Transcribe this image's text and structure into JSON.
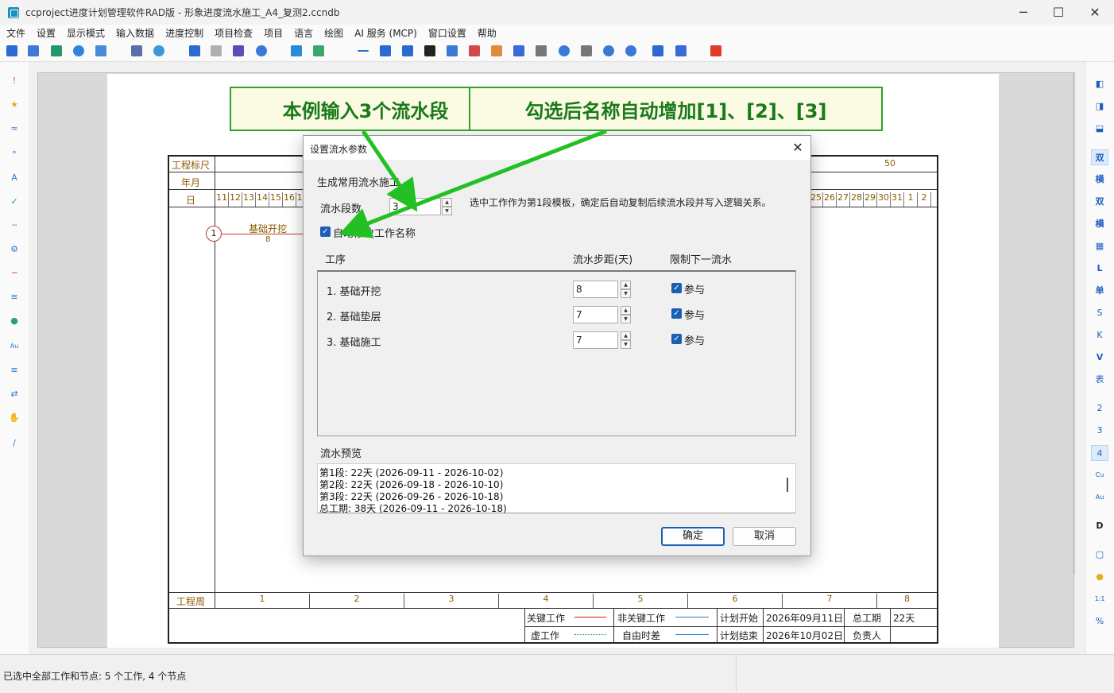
{
  "window": {
    "title": "ccproject进度计划管理软件RAD版 - 形象进度流水施工_A4_复测2.ccndb",
    "min_icon": "─",
    "max_icon": "☐",
    "close_icon": "✕"
  },
  "menu": [
    "文件",
    "设置",
    "显示模式",
    "输入数据",
    "进度控制",
    "项目检查",
    "项目",
    "语言",
    "绘图",
    "AI 服务 (MCP)",
    "窗口设置",
    "帮助"
  ],
  "right_sidebar": [
    "双",
    "横",
    "双",
    "横",
    "L",
    "单",
    "S",
    "K",
    "V",
    "表",
    "2",
    "3",
    "4",
    "Cu",
    "Au",
    "D",
    "1:1",
    "%"
  ],
  "chart": {
    "ruler_label": "工程标尺",
    "ruler_mark": "50",
    "yearmonth_label": "年月",
    "day_label": "日",
    "days_left": [
      "11",
      "12",
      "13",
      "14",
      "15",
      "16",
      "1"
    ],
    "days_right": [
      "25",
      "26",
      "27",
      "28",
      "29",
      "30",
      "31",
      "1",
      "2"
    ],
    "task_node": "1",
    "task_name": "基础开挖",
    "task_duration": "8",
    "week_label": "工程周",
    "weeks": [
      "1",
      "2",
      "3",
      "4",
      "5",
      "6",
      "7",
      "8"
    ],
    "legend": {
      "critical": "关键工作",
      "noncritical": "非关键工作",
      "plan_start_label": "计划开始",
      "plan_start": "2026年09月11日",
      "total_period_label": "总工期",
      "total_period": "22天",
      "virtual": "虚工作",
      "free_float": "自由时差",
      "plan_end_label": "计划结束",
      "plan_end": "2026年10月02日",
      "owner_label": "负责人",
      "owner": ""
    }
  },
  "callouts": {
    "left": "本例输入3个流水段",
    "right": "勾选后名称自动增加[1]、[2]、[3]"
  },
  "dialog": {
    "title": "设置流水参数",
    "close_icon": "✕",
    "section_title": "生成常用流水施工",
    "count_label": "流水段数",
    "count_value": "3",
    "hint": "选中工作作为第1段模板，确定后自动复制后续流水段并写入逻辑关系。",
    "auto_rename_label": "自动修改工作名称",
    "auto_rename_checked": true,
    "col_process": "工序",
    "col_step": "流水步距(天)",
    "col_limit": "限制下一流水",
    "rows": [
      {
        "name": "1. 基础开挖",
        "step": "8",
        "participate": "参与",
        "checked": true
      },
      {
        "name": "2. 基础垫层",
        "step": "7",
        "participate": "参与",
        "checked": true
      },
      {
        "name": "3. 基础施工",
        "step": "7",
        "participate": "参与",
        "checked": true
      }
    ],
    "preview_title": "流水预览",
    "preview_lines": [
      "第1段: 22天 (2026-09-11 - 2026-10-02)",
      "第2段: 22天 (2026-09-18 - 2026-10-10)",
      "第3段: 22天 (2026-09-26 - 2026-10-18)",
      "总工期: 38天 (2026-09-11 - 2026-10-18)"
    ],
    "ok": "确定",
    "cancel": "取消"
  },
  "status": "已选中全部工作和节点: 5 个工作, 4 个节点",
  "colors": {
    "accent_green": "#2ea02e",
    "callout_bg": "#fbfbe4",
    "checkbox_blue": "#1a5fb4",
    "chart_brown": "#8b5a00",
    "critical_red": "#e01010",
    "noncritical_blue": "#1e7fd8"
  }
}
